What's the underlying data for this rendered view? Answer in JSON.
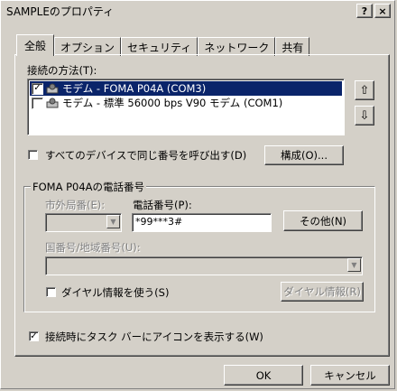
{
  "window": {
    "title": "SAMPLEのプロパティ",
    "help_btn": "?",
    "close_btn": "×"
  },
  "tabs": [
    {
      "label": "全般",
      "active": true
    },
    {
      "label": "オプション"
    },
    {
      "label": "セキュリティ"
    },
    {
      "label": "ネットワーク"
    },
    {
      "label": "共有"
    }
  ],
  "connect_method": {
    "label": "接続の方法(T):",
    "items": [
      {
        "checked": true,
        "text": "モデム - FOMA P04A (COM3)",
        "selected": true
      },
      {
        "checked": false,
        "text": "モデム - 標準 56000 bps V90 モデム (COM1)",
        "selected": false
      }
    ],
    "up_icon": "⇧",
    "down_icon": "⇩"
  },
  "same_number": {
    "checked": false,
    "label": "すべてのデバイスで同じ番号を呼び出す(D)"
  },
  "configure_button": "構成(O)...",
  "phone_group": {
    "title": "FOMA P04Aの電話番号",
    "area_code_label": "市外局番(E):",
    "area_code_value": "",
    "phone_label": "電話番号(P):",
    "phone_value": "*99***3#",
    "other_button": "その他(N)",
    "country_label": "国番号/地域番号(U):",
    "country_value": "",
    "dialing_rules": {
      "checked": false,
      "label": "ダイヤル情報を使う(S)"
    },
    "dialing_rules_button": "ダイヤル情報(R)"
  },
  "show_icon": {
    "checked": true,
    "label": "接続時にタスク バーにアイコンを表示する(W)"
  },
  "footer": {
    "ok": "OK",
    "cancel": "キャンセル"
  }
}
